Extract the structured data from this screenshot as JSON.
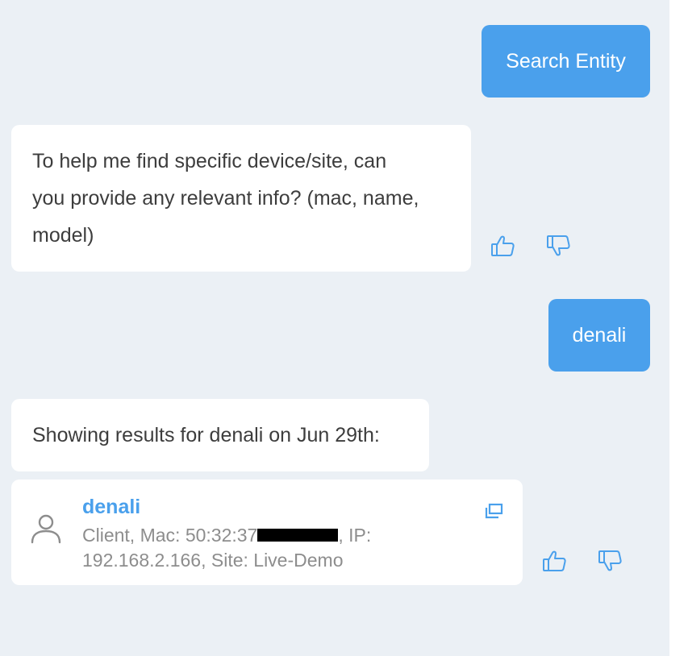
{
  "messages": {
    "user_1": "Search Entity",
    "bot_1_line_1": "To help me find specific device/site, can",
    "bot_1_line_2": "you provide any relevant info? (mac, name,",
    "bot_1_line_3": "model)",
    "user_2": "denali",
    "bot_2": "Showing results for denali on Jun 29th:"
  },
  "result": {
    "title": "denali",
    "detail_line_1_prefix": "Client, Mac: 50:32:37",
    "detail_line_1_suffix": ", IP:",
    "detail_line_2": "192.168.2.166, Site: Live-Demo"
  },
  "icons": {
    "thumbs_up": "thumbs-up-icon",
    "thumbs_down": "thumbs-down-icon",
    "client": "user-icon",
    "open_in_new": "open-window-icon"
  },
  "colors": {
    "accent": "#4aa0ec",
    "panel_background": "#ebf0f5",
    "bot_text": "#3d3d3d",
    "muted_text": "#8d8d8d"
  }
}
